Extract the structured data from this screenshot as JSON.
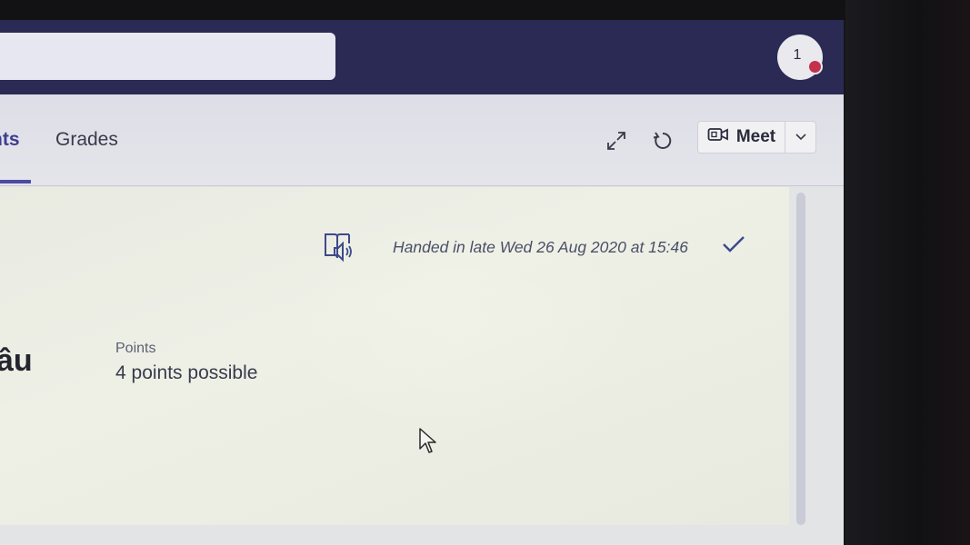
{
  "header": {
    "avatar_initial": "1"
  },
  "tabs": [
    {
      "label": "nts"
    },
    {
      "label": "Grades"
    }
  ],
  "toolbar": {
    "meet_label": "Meet",
    "expand_icon": "expand-icon",
    "refresh_icon": "refresh-icon",
    "meet_icon": "video-camera-icon",
    "dropdown_icon": "chevron-down-icon"
  },
  "assignment": {
    "status": "Handed in late Wed 26 Aug 2020 at 15:46",
    "title_fragment": "âu",
    "points_label": "Points",
    "points_value": "4 points possible"
  },
  "colors": {
    "topbar": "#2a2a55",
    "accent": "#4b4ba3",
    "presence": "#c4314b"
  }
}
